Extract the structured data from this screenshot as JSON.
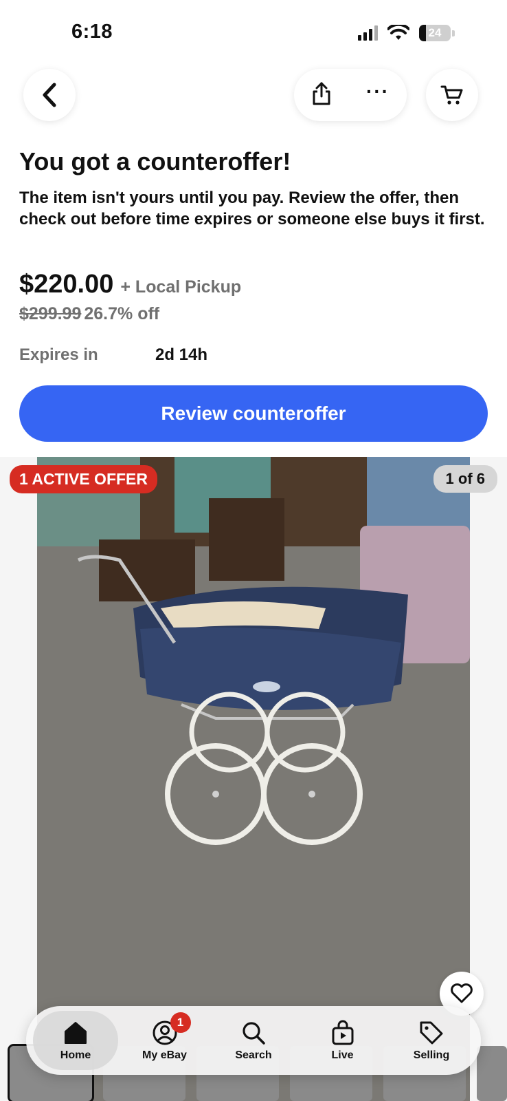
{
  "status_bar": {
    "time": "6:18",
    "battery": "24"
  },
  "nav": {
    "back_icon": "chevron-left-icon",
    "share_icon": "share-icon",
    "more_icon": "more-icon",
    "cart_icon": "cart-icon",
    "more_label": "···"
  },
  "offer": {
    "title": "You got a counteroffer!",
    "description": "The item isn't yours until you pay. Review the offer, then check out before time expires or someone else buys it first.",
    "price": "$220.00",
    "shipping": "+ Local Pickup",
    "original_price": "$299.99",
    "discount": "26.7% off",
    "expires_label": "Expires in",
    "expires_value": "2d 14h",
    "cta_label": "Review counteroffer",
    "cta_color": "#3665f3"
  },
  "gallery": {
    "active_offer_badge": "1 ACTIVE OFFER",
    "image_counter": "1 of 6",
    "badge_color": "#d62c22"
  },
  "tab_bar": {
    "tabs": [
      {
        "label": "Home",
        "icon": "home-icon",
        "active": true
      },
      {
        "label": "My eBay",
        "icon": "profile-icon",
        "badge": "1"
      },
      {
        "label": "Search",
        "icon": "search-icon"
      },
      {
        "label": "Live",
        "icon": "live-icon"
      },
      {
        "label": "Selling",
        "icon": "tag-icon"
      }
    ]
  }
}
